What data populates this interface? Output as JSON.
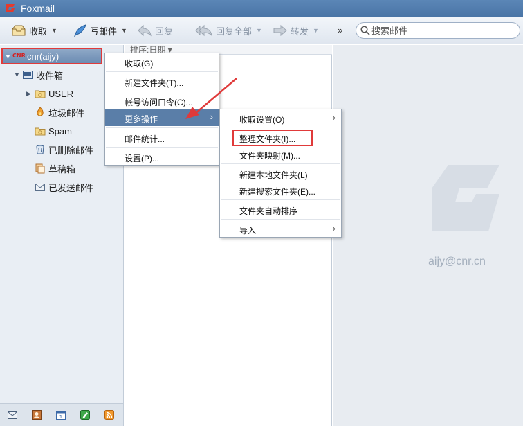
{
  "app": {
    "title": "Foxmail",
    "brand_color": "#e33b2e",
    "titlebar_color": "#4f7aab"
  },
  "toolbar": {
    "receive_label": "收取",
    "compose_label": "写邮件",
    "reply_label": "回复",
    "reply_all_label": "回复全部",
    "forward_label": "转发",
    "more_label": "»",
    "search_placeholder": "搜索邮件"
  },
  "sidebar": {
    "account": {
      "badge": "CNR",
      "label": "cnr(aijy)"
    },
    "folders": [
      {
        "label": "收件箱",
        "icon": "inbox-icon"
      },
      {
        "label": "USER",
        "icon": "folder-icon"
      },
      {
        "label": "垃圾邮件",
        "icon": "junk-icon"
      },
      {
        "label": "Spam",
        "icon": "folder-icon"
      },
      {
        "label": "已删除邮件",
        "icon": "trash-icon"
      },
      {
        "label": "草稿箱",
        "icon": "drafts-icon"
      },
      {
        "label": "已发送邮件",
        "icon": "sent-icon"
      }
    ],
    "bottom_icons": [
      "mail-icon",
      "contacts-icon",
      "calendar-icon",
      "notes-icon",
      "rss-icon"
    ]
  },
  "list": {
    "sort_label": "排序:日期 ▾"
  },
  "preview": {
    "account_email": "aijy@cnr.cn"
  },
  "context_menu": {
    "items": [
      {
        "label": "收取(G)"
      },
      {
        "label": "新建文件夹(T)..."
      },
      {
        "label": "帐号访问口令(C)..."
      },
      {
        "label": "更多操作"
      },
      {
        "label": "邮件统计..."
      },
      {
        "label": "设置(P)..."
      }
    ],
    "submenu_arrow": "›"
  },
  "submenu": {
    "items": [
      {
        "label": "收取设置(O)"
      },
      {
        "label": "整理文件夹(I)..."
      },
      {
        "label": "文件夹映射(M)..."
      },
      {
        "label": "新建本地文件夹(L)"
      },
      {
        "label": "新建搜索文件夹(E)..."
      },
      {
        "label": "文件夹自动排序"
      },
      {
        "label": "导入"
      }
    ],
    "arrow": "›"
  },
  "colors": {
    "highlight": "#5a7ea8",
    "annotation_red": "#e03a3a"
  }
}
